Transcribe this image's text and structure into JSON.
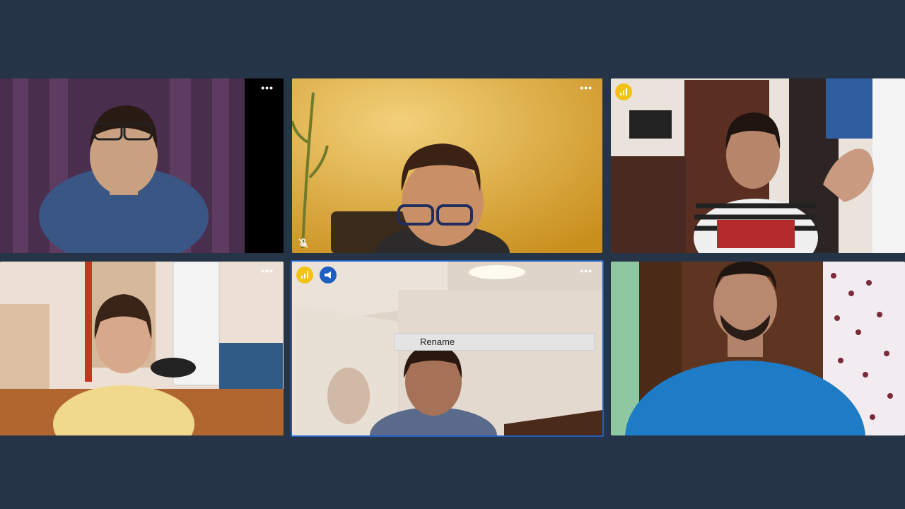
{
  "meeting": {
    "participants": [
      {
        "id": "p1",
        "more_label": "•••",
        "active_speaker": false,
        "muted": false,
        "signal": false,
        "share": false
      },
      {
        "id": "p2",
        "more_label": "•••",
        "active_speaker": false,
        "muted": true,
        "signal": false,
        "share": false
      },
      {
        "id": "p3",
        "more_label": "•••",
        "active_speaker": false,
        "muted": false,
        "signal": true,
        "share": false
      },
      {
        "id": "p4",
        "more_label": "•••",
        "active_speaker": false,
        "muted": false,
        "signal": false,
        "share": false
      },
      {
        "id": "p5",
        "more_label": "•••",
        "active_speaker": true,
        "muted": false,
        "signal": true,
        "share": true
      },
      {
        "id": "p6",
        "more_label": "",
        "active_speaker": false,
        "muted": false,
        "signal": false,
        "share": false
      }
    ],
    "context_menu": {
      "rename_label": "Rename"
    },
    "colors": {
      "background": "#253447",
      "active_border": "#1f5fbf",
      "signal_badge": "#f2c315",
      "share_badge": "#1f5fbf"
    }
  }
}
